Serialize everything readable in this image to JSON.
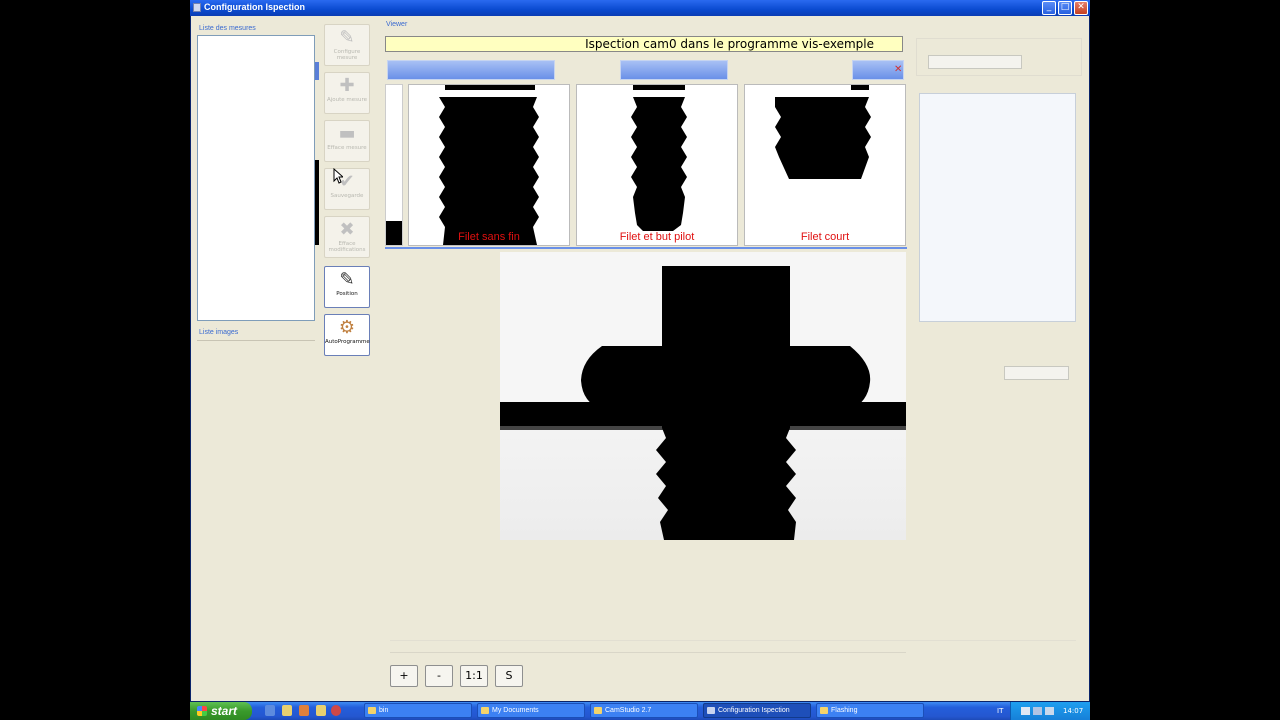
{
  "window": {
    "title": "Configuration Ispection",
    "buttons": [
      "_",
      "□",
      "✕"
    ]
  },
  "left_panel": {
    "measures_label": "Liste des mesures",
    "images_label": "Liste images"
  },
  "toolbar": {
    "configure": "Configure mesure",
    "add": "Ajoute mesure",
    "delete": "Efface mesure",
    "save": "Sauvegarde",
    "cancel": "Efface modifications",
    "position": "Position",
    "autoprog": "AutoProgramme"
  },
  "viewer": {
    "label": "Viewer",
    "banner": "Ispection cam0 dans le programme vis-exemple",
    "thumbnails": [
      {
        "caption": "Filet sans fin"
      },
      {
        "caption": "Filet et but pilot"
      },
      {
        "caption": "Filet court"
      }
    ]
  },
  "zoom": {
    "plus": "+",
    "minus": "-",
    "one_to_one": "1:1",
    "s": "S"
  },
  "taskbar": {
    "start": "start",
    "tasks": [
      "bin",
      "My Documents",
      "CamStudio 2.7",
      "Configuration Ispection",
      "Flashing"
    ],
    "lang": "IT",
    "time": "14:07"
  },
  "colors": {
    "title_blue": "#0a4ad0",
    "caption_red": "#e01010",
    "banner_yellow": "#ffffc0"
  }
}
